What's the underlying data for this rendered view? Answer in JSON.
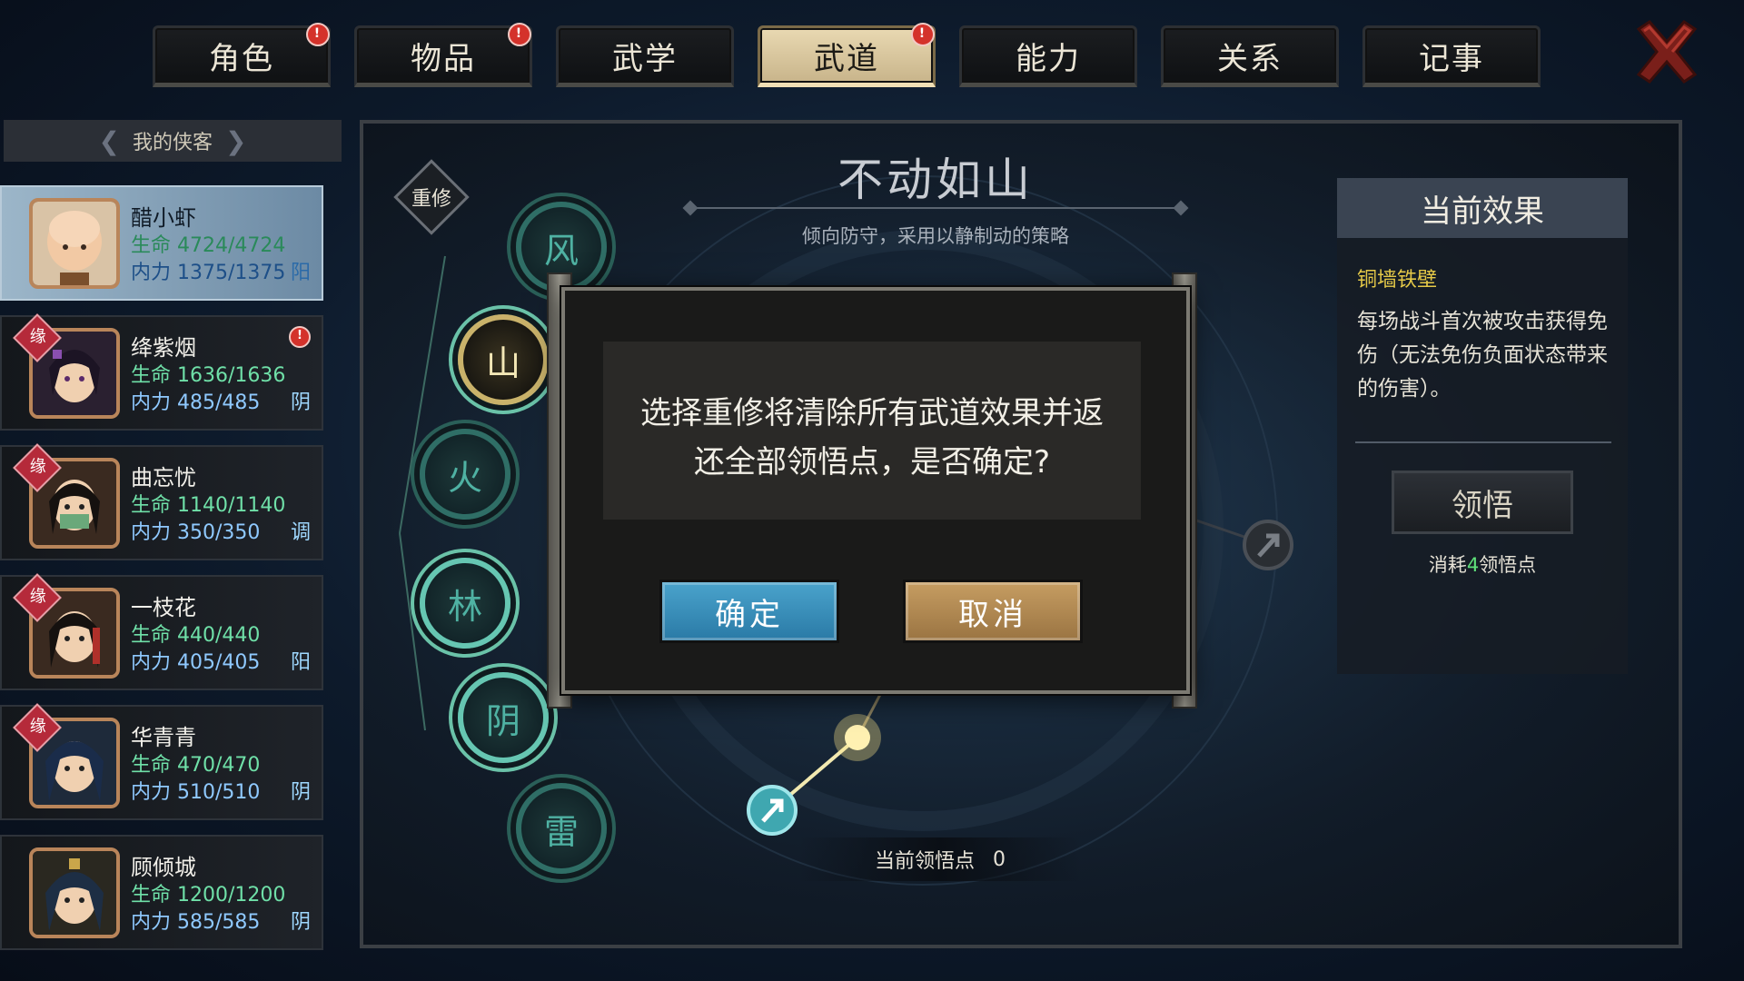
{
  "tabs": [
    {
      "label": "角色",
      "alert": true,
      "active": false
    },
    {
      "label": "物品",
      "alert": true,
      "active": false
    },
    {
      "label": "武学",
      "alert": false,
      "active": false
    },
    {
      "label": "武道",
      "alert": true,
      "active": true
    },
    {
      "label": "能力",
      "alert": false,
      "active": false
    },
    {
      "label": "关系",
      "alert": false,
      "active": false
    },
    {
      "label": "记事",
      "alert": false,
      "active": false
    }
  ],
  "alert_glyph": "!",
  "close_icon": "close-x-icon",
  "roster": {
    "header": "我的侠客",
    "heroes": [
      {
        "name": "醋小虾",
        "hp": "生命 4724/4724",
        "mp": "内力 1375/1375",
        "type": "阳",
        "fate": "",
        "alert": false,
        "selected": true
      },
      {
        "name": "绛紫烟",
        "hp": "生命 1636/1636",
        "mp": "内力 485/485",
        "type": "阴",
        "fate": "缘",
        "alert": true,
        "selected": false
      },
      {
        "name": "曲忘忧",
        "hp": "生命 1140/1140",
        "mp": "内力 350/350",
        "type": "调",
        "fate": "缘",
        "alert": false,
        "selected": false
      },
      {
        "name": "一枝花",
        "hp": "生命 440/440",
        "mp": "内力 405/405",
        "type": "阳",
        "fate": "缘",
        "alert": false,
        "selected": false
      },
      {
        "name": "华青青",
        "hp": "生命 470/470",
        "mp": "内力 510/510",
        "type": "阴",
        "fate": "缘",
        "alert": false,
        "selected": false
      },
      {
        "name": "顾倾城",
        "hp": "生命 1200/1200",
        "mp": "内力 585/585",
        "type": "阴",
        "fate": "",
        "alert": false,
        "selected": false
      }
    ]
  },
  "main": {
    "reset_label": "重修",
    "skill_title": "不动如山",
    "skill_desc": "倾向防守，采用以静制动的策略",
    "elements": [
      {
        "label": "风",
        "state": "normal"
      },
      {
        "label": "山",
        "state": "active"
      },
      {
        "label": "火",
        "state": "normal"
      },
      {
        "label": "林",
        "state": "lit"
      },
      {
        "label": "阴",
        "state": "lit"
      },
      {
        "label": "雷",
        "state": "normal"
      }
    ],
    "points_label": "当前领悟点",
    "points_value": "0"
  },
  "effect": {
    "header": "当前效果",
    "name": "铜墙铁壁",
    "text": "每场战斗首次被攻击获得免伤（无法免伤负面状态带来的伤害）。",
    "button": "领悟",
    "cost_prefix": "消耗",
    "cost_num": "4",
    "cost_suffix": "领悟点"
  },
  "modal": {
    "message_line1": "选择重修将清除所有武道效果并返",
    "message_line2": "还全部领悟点，是否确定?",
    "confirm": "确定",
    "cancel": "取消"
  },
  "colors": {
    "accent_confirm": "#2a7aa6",
    "accent_cancel": "#9a7442",
    "effect_name": "#e5c948",
    "alert": "#d4322b"
  }
}
